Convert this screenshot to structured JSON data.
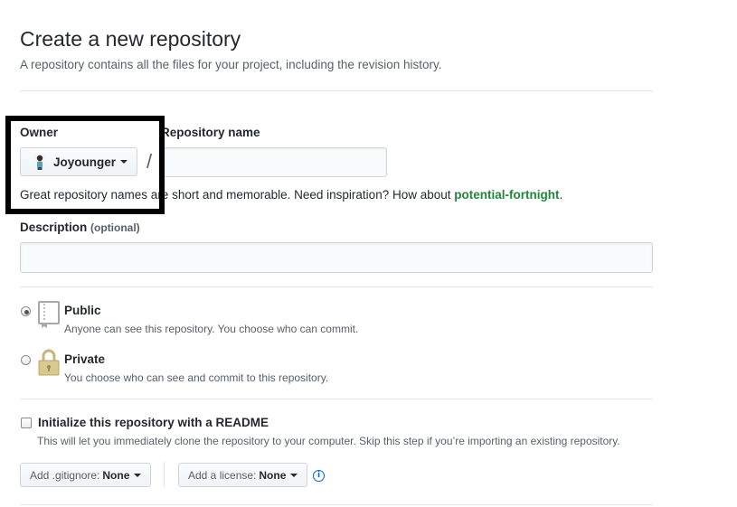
{
  "header": {
    "title": "Create a new repository",
    "subtitle": "A repository contains all the files for your project, including the revision history."
  },
  "owner": {
    "label": "Owner",
    "selected": "Joyounger",
    "separator": "/"
  },
  "repo_name": {
    "label": "Repository name",
    "value": "",
    "hint_prefix": "Great repository names are short and memorable. Need inspiration? How about ",
    "suggestion": "potential-fortnight",
    "hint_suffix": "."
  },
  "description": {
    "label": "Description",
    "optional": "(optional)",
    "value": ""
  },
  "visibility": {
    "selected": "public",
    "public": {
      "title": "Public",
      "desc": "Anyone can see this repository. You choose who can commit."
    },
    "private": {
      "title": "Private",
      "desc": "You choose who can see and commit to this repository."
    }
  },
  "readme": {
    "checked": false,
    "label": "Initialize this repository with a README",
    "desc": "This will let you immediately clone the repository to your computer. Skip this step if you’re importing an existing repository."
  },
  "gitignore": {
    "prefix": "Add .gitignore:",
    "value": "None"
  },
  "license": {
    "prefix": "Add a license:",
    "value": "None"
  },
  "info_icon_glyph": "i",
  "colors": {
    "suggestion": "#22863a",
    "info": "#0366d6",
    "highlight_border": "#000000"
  }
}
